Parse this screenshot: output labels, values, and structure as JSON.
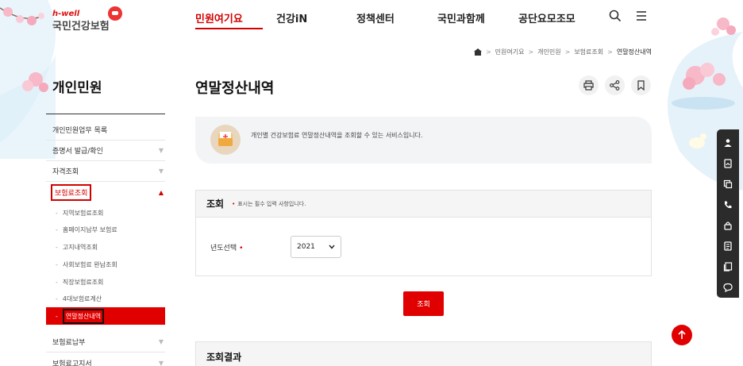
{
  "brand": {
    "tagline": "h-well",
    "name": "국민건강보험"
  },
  "gnb": [
    "민원여기요",
    "건강iN",
    "정책센터",
    "국민과함께",
    "공단요모조모"
  ],
  "breadcrumb": [
    "민원여기요",
    "개인민원",
    "보험료조회",
    "연말정산내역"
  ],
  "sidebar": {
    "title": "개인민원",
    "items": [
      {
        "label": "개인민원업무 목록",
        "chevron": ""
      },
      {
        "label": "증명서 발급/확인",
        "chevron": "▼"
      },
      {
        "label": "자격조회",
        "chevron": "▼"
      },
      {
        "label": "보험료조회",
        "chevron": "▲"
      }
    ],
    "sub_items": [
      "지역보험료조회",
      "홈페이지납부 보험료",
      "고지내역조회",
      "사회보험료 완납조회",
      "직장보험료조회",
      "4대보험료계산"
    ],
    "sub_active": "연말정산내역",
    "after_items": [
      {
        "label": "보험료납부",
        "chevron": "▼"
      },
      {
        "label": "보험료고지서",
        "chevron": "▼"
      }
    ]
  },
  "page": {
    "title": "연말정산내역",
    "info": "개인별 건강보험료 연말정산내역을 조회할 수 있는 서비스입니다."
  },
  "query": {
    "title": "조회",
    "required_note": "표시는 필수 입력 사항입니다.",
    "required_mark": "•",
    "year_label": "년도선택",
    "year_value": "2021",
    "button": "조회"
  },
  "result": {
    "title": "조회결과"
  },
  "colors": {
    "accent": "#e00000",
    "text": "#222222",
    "panel": "#f5f5f5"
  },
  "icons": {
    "top": [
      "search-icon",
      "menu-icon"
    ],
    "tools": [
      "print-icon",
      "share-icon",
      "bookmark-icon"
    ],
    "quick": [
      "person-icon",
      "document-icon",
      "copy-icon",
      "phone-icon",
      "lock-icon",
      "file-icon",
      "pages-icon",
      "chat-icon"
    ]
  }
}
